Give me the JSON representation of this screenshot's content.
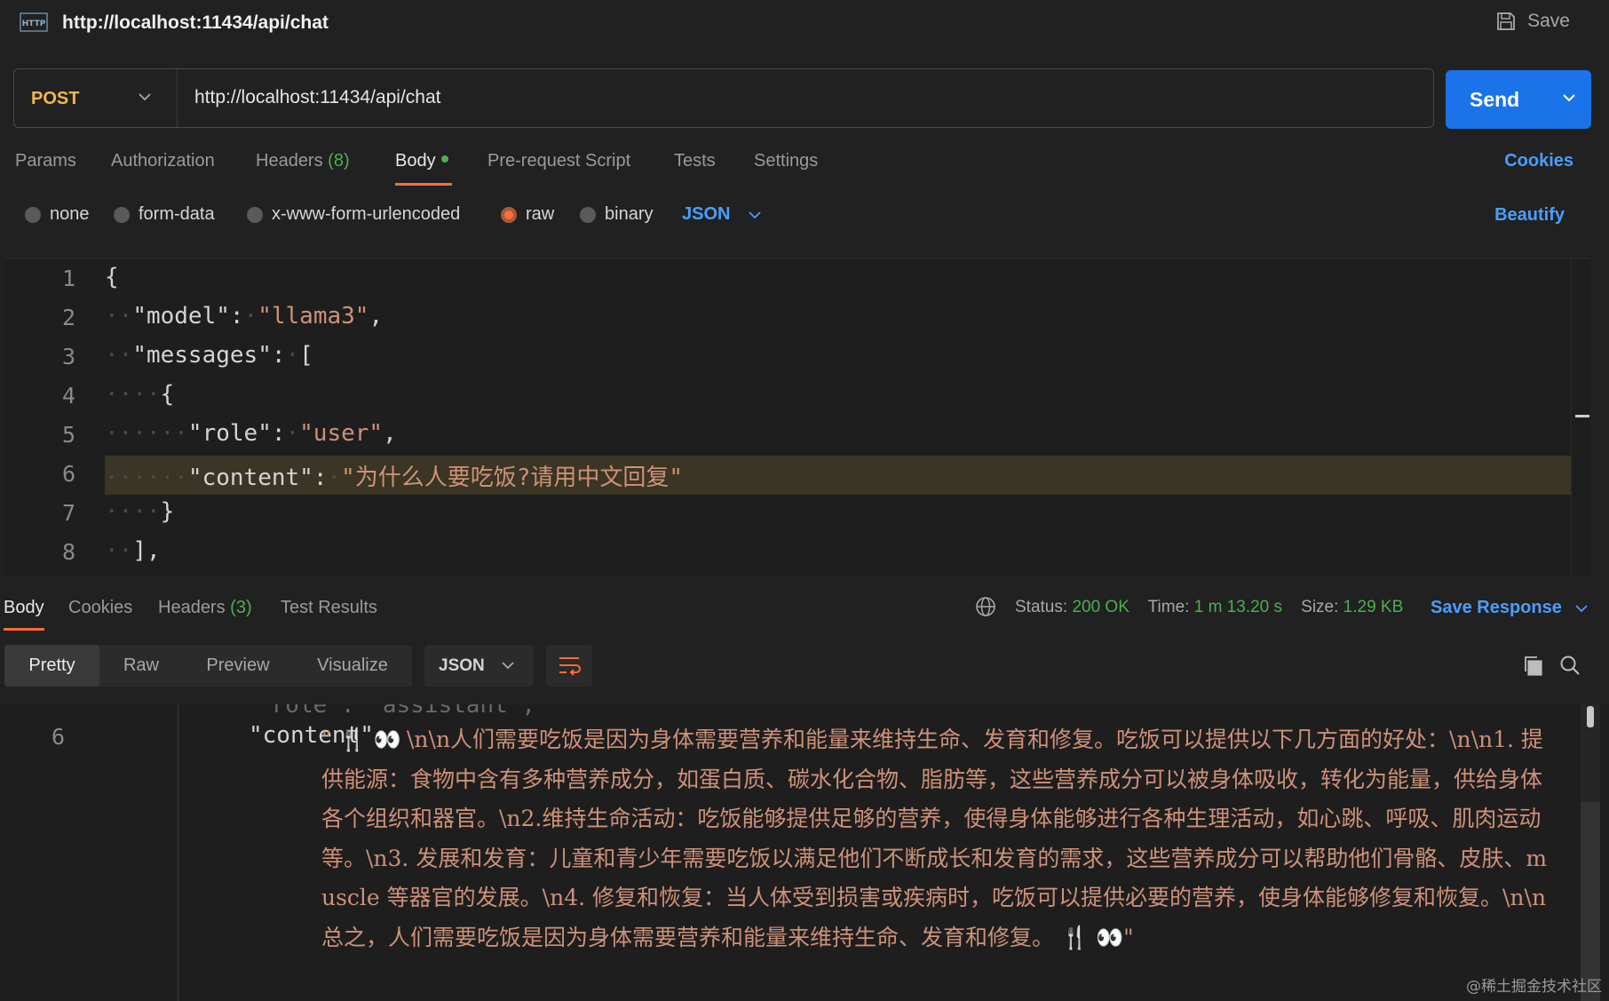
{
  "header": {
    "tab_title": "http://localhost:11434/api/chat",
    "save_label": "Save",
    "icon": "http-icon"
  },
  "request": {
    "method": "POST",
    "url": "http://localhost:11434/api/chat",
    "send_label": "Send",
    "tabs": [
      {
        "label": "Params"
      },
      {
        "label": "Authorization"
      },
      {
        "label": "Headers",
        "count": "(8)"
      },
      {
        "label": "Body",
        "active": true
      },
      {
        "label": "Pre-request Script"
      },
      {
        "label": "Tests"
      },
      {
        "label": "Settings"
      }
    ],
    "cookies_label": "Cookies",
    "body_types": [
      "none",
      "form-data",
      "x-www-form-urlencoded",
      "raw",
      "binary"
    ],
    "selected_body_type": "raw",
    "format": "JSON",
    "beautify_label": "Beautify",
    "code_lines": [
      {
        "n": "1",
        "text": "{"
      },
      {
        "n": "2",
        "key": "\"model\"",
        "value": "\"llama3\""
      },
      {
        "n": "3",
        "key": "\"messages\"",
        "rest": "["
      },
      {
        "n": "4",
        "text": "{"
      },
      {
        "n": "5",
        "key": "\"role\"",
        "value": "\"user\""
      },
      {
        "n": "6",
        "key": "\"content\"",
        "value": "\"为什么人要吃饭?请用中文回复\""
      },
      {
        "n": "7",
        "text": "}"
      },
      {
        "n": "8",
        "text": "],"
      }
    ]
  },
  "response": {
    "tabs": [
      {
        "label": "Body",
        "active": true
      },
      {
        "label": "Cookies"
      },
      {
        "label": "Headers",
        "count": "(3)"
      },
      {
        "label": "Test Results"
      }
    ],
    "status_label": "Status:",
    "status_value": "200 OK",
    "time_label": "Time:",
    "time_value": "1 m 13.20 s",
    "size_label": "Size:",
    "size_value": "1.29 KB",
    "save_response_label": "Save Response",
    "views": [
      "Pretty",
      "Raw",
      "Preview",
      "Visualize"
    ],
    "active_view": "Pretty",
    "format": "JSON",
    "ghost_line": "\"role\": \"assistant\",",
    "line_number": "6",
    "content_key": "\"content\":",
    "content_lead": "\" 🍴 👀 ",
    "content_text": "\\n\\n人们需要吃饭是因为身体需要营养和能量来维持生命、发育和修复。吃饭可以提供以下几方面的好处：\\n\\n1. 提供能源：食物中含有多种营养成分，如蛋白质、碳水化合物、脂肪等，这些营养成分可以被身体吸收，转化为能量，供给身体各个组织和器官。\\n2.维持生命活动：吃饭能够提供足够的营养，使得身体能够进行各种生理活动，如心跳、呼吸、肌肉运动等。\\n3. 发展和发育：儿童和青少年需要吃饭以满足他们不断成长和发育的需求，这些营养成分可以帮助他们骨骼、皮肤、muscle 等器官的发展。\\n4. 修复和恢复：当人体受到损害或疾病时，吃饭可以提供必要的营养，使身体能够修复和恢复。\\n\\n总之，人们需要吃饭是因为身体需要营养和能量来维持生命、发育和修复。 🍴 👀\""
  },
  "watermark": "@稀土掘金技术社区",
  "colors": {
    "background": "#212121",
    "accent": "#ff6c37",
    "link": "#4a9eff",
    "send": "#1a73e8",
    "method": "#f2b84b",
    "string": "#ce9178",
    "ok": "#4caf50"
  }
}
